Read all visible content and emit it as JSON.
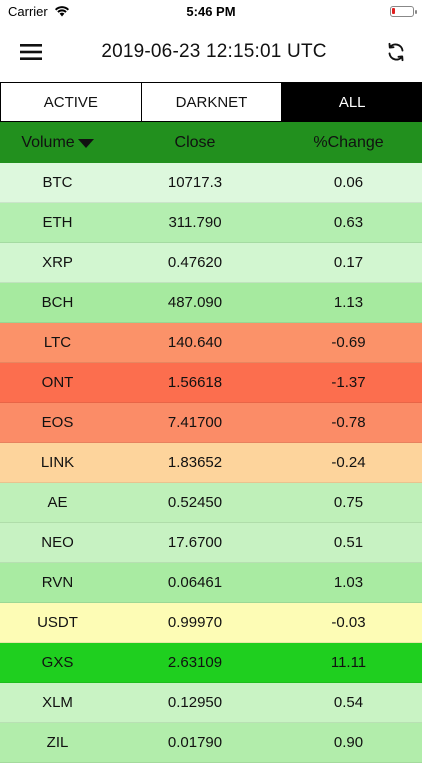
{
  "status_bar": {
    "carrier": "Carrier",
    "time": "5:46 PM"
  },
  "navbar": {
    "title": "2019-06-23 12:15:01 UTC"
  },
  "segments": [
    {
      "label": "ACTIVE",
      "selected": false
    },
    {
      "label": "DARKNET",
      "selected": false
    },
    {
      "label": "ALL",
      "selected": true
    }
  ],
  "table": {
    "headers": [
      "Volume",
      "Close",
      "%Change"
    ],
    "rows": [
      {
        "symbol": "BTC",
        "close": "10717.3",
        "change": "0.06",
        "color": "#ddf8dd"
      },
      {
        "symbol": "ETH",
        "close": "311.790",
        "change": "0.63",
        "color": "#b4eeb0"
      },
      {
        "symbol": "XRP",
        "close": "0.47620",
        "change": "0.17",
        "color": "#d2f6d0"
      },
      {
        "symbol": "BCH",
        "close": "487.090",
        "change": "1.13",
        "color": "#a6ea9f"
      },
      {
        "symbol": "LTC",
        "close": "140.640",
        "change": "-0.69",
        "color": "#fb9269"
      },
      {
        "symbol": "ONT",
        "close": "1.56618",
        "change": "-1.37",
        "color": "#fc6e4e"
      },
      {
        "symbol": "EOS",
        "close": "7.41700",
        "change": "-0.78",
        "color": "#fb8c67"
      },
      {
        "symbol": "LINK",
        "close": "1.83652",
        "change": "-0.24",
        "color": "#fdd49c"
      },
      {
        "symbol": "AE",
        "close": "0.52450",
        "change": "0.75",
        "color": "#bff0b9"
      },
      {
        "symbol": "NEO",
        "close": "17.6700",
        "change": "0.51",
        "color": "#c7f2c2"
      },
      {
        "symbol": "RVN",
        "close": "0.06461",
        "change": "1.03",
        "color": "#a9eba2"
      },
      {
        "symbol": "USDT",
        "close": "0.99970",
        "change": "-0.03",
        "color": "#fdfcb5"
      },
      {
        "symbol": "GXS",
        "close": "2.63109",
        "change": "11.11",
        "color": "#1fcf1f"
      },
      {
        "symbol": "XLM",
        "close": "0.12950",
        "change": "0.54",
        "color": "#c9f3c4"
      },
      {
        "symbol": "ZIL",
        "close": "0.01790",
        "change": "0.90",
        "color": "#b2edab"
      }
    ]
  }
}
